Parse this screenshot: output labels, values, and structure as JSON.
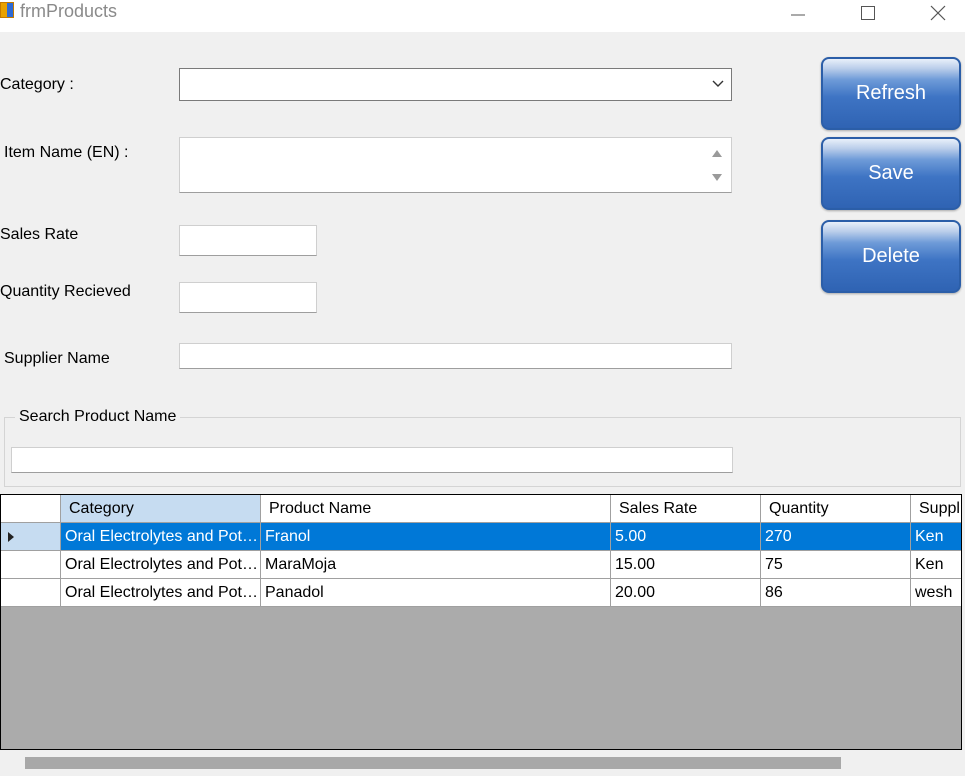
{
  "window": {
    "title": "frmProducts"
  },
  "form": {
    "category_label": "Category :",
    "category_value": "",
    "item_name_label": "Item Name (EN) :",
    "item_name_value": "",
    "sales_rate_label": "Sales Rate",
    "sales_rate_value": "",
    "quantity_label": "Quantity Recieved",
    "quantity_value": "",
    "supplier_label": "Supplier Name",
    "supplier_value": ""
  },
  "buttons": {
    "refresh": "Refresh",
    "save": "Save",
    "delete": "Delete"
  },
  "search": {
    "group_title": "Search Product Name",
    "value": ""
  },
  "grid": {
    "columns": [
      "Category",
      "Product Name",
      "Sales Rate",
      "Quantity",
      "Suppl"
    ],
    "rows": [
      {
        "category": "Oral Electrolytes and Potassium",
        "product": "Franol",
        "rate": "5.00",
        "qty": "270",
        "supplier": "Ken"
      },
      {
        "category": "Oral Electrolytes and Potassium",
        "product": "MaraMoja",
        "rate": "15.00",
        "qty": "75",
        "supplier": "Ken"
      },
      {
        "category": "Oral Electrolytes and Potassium",
        "product": "Panadol",
        "rate": "20.00",
        "qty": "86",
        "supplier": "wesh"
      }
    ],
    "selected_row": 0
  },
  "icons": {
    "app": "app-icon",
    "minimize": "minimize-icon",
    "maximize": "maximize-icon",
    "close": "close-icon",
    "dropdown": "chevron-down-icon",
    "row_pointer": "row-pointer-icon"
  },
  "colors": {
    "selection": "#0078d7",
    "header_active": "#c6dcf1",
    "button_blue": "#2f63b3"
  }
}
